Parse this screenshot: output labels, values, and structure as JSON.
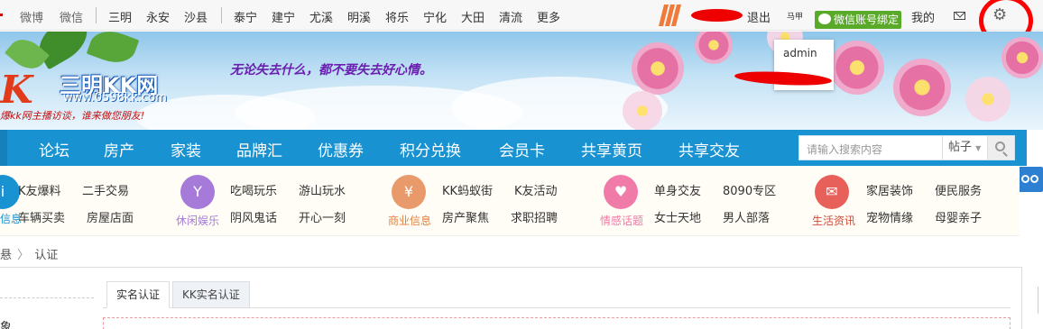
{
  "topbar": {
    "weibo": "微博",
    "weixin": "微信",
    "cities": [
      "三明",
      "永安",
      "沙县",
      "泰宁",
      "建宁",
      "尤溪",
      "明溪",
      "将乐",
      "宁化",
      "大田",
      "清流",
      "更多"
    ],
    "logout": "退出",
    "wechat_bind": "微信账号绑定",
    "mine": "我的",
    "icons": {
      "mail": "mail-icon",
      "gear": "gear-icon",
      "stripes": "stripes-logo-icon"
    },
    "annotation_color": "#ff0000"
  },
  "banner": {
    "logo_title": "三明KK网",
    "logo_url": "www.0598kk.com",
    "logo_slogan": "爆kk网主播访谈，谁来做您朋友!",
    "motto": "无论失去什么，都不要失去好心情。"
  },
  "dropdown": {
    "user": "admin"
  },
  "nav": {
    "items": [
      "论坛",
      "房产",
      "家装",
      "品牌汇",
      "优惠券",
      "积分兑换",
      "会员卡",
      "共享黄页",
      "共享交友"
    ],
    "search_placeholder": "请输入搜索内容",
    "search_scope": "帖子",
    "color": "#1992d1"
  },
  "categories": {
    "groups": [
      {
        "label": "信息",
        "color": "#1992d1",
        "icon": "info-icon",
        "links": [
          "K友爆料",
          "二手交易",
          "车辆买卖",
          "房屋店面"
        ]
      },
      {
        "label": "休闲娱乐",
        "color": "#a57ad8",
        "icon": "cocktail-icon",
        "links": [
          "吃喝玩乐",
          "游山玩水",
          "阴风鬼话",
          "开心一刻"
        ]
      },
      {
        "label": "商业信息",
        "color": "#e99a6b",
        "icon": "fork-knife-icon",
        "links": [
          "KK蚂蚁街",
          "K友活动",
          "房产聚焦",
          "求职招聘"
        ]
      },
      {
        "label": "情感话题",
        "color": "#f07aa8",
        "icon": "heart-icon",
        "links": [
          "单身交友",
          "8090专区",
          "女士天地",
          "男人部落"
        ]
      },
      {
        "label": "生活资讯",
        "color": "#e8605a",
        "icon": "envelope-icon",
        "links": [
          "家居装饰",
          "便民服务",
          "宠物情缘",
          "母婴亲子"
        ]
      }
    ]
  },
  "breadcrumb": {
    "sep": "〉",
    "current": "认证",
    "prefix": "悬"
  },
  "tabs": [
    "实名认证",
    "KK实名认证"
  ],
  "form": {
    "left_label": "象"
  }
}
